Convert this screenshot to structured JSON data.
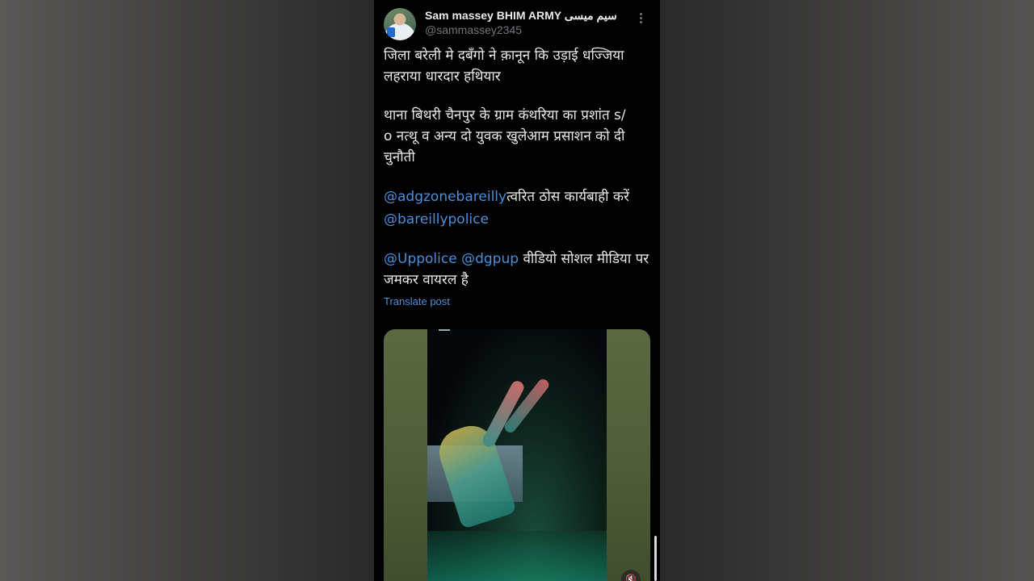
{
  "post": {
    "author_name": "Sam massey BHIM ARMY سیم میسی",
    "author_handle": "@sammassey2345",
    "line1": "जिला बरेली मे दबँगो ने क़ानून कि उड़ाई धज्जिया",
    "line2": "लहराया धारदार हथियार",
    "para2_line1": "थाना बिथरी चैनपुर के ग्राम कंथरिया का प्रशांत s/",
    "para2_line2": "o नत्थू व अन्य दो युवक खुलेआम प्रसाशन को दी",
    "para2_line3": "चुनौती",
    "mention1": "@adgzonebareilly",
    "mention1_text": "त्वरित ठोस कार्यबाही करें",
    "mention2": "@bareillypolice",
    "mention3": "@Uppolice",
    "mention4": "@dgpup",
    "para4_text": " वीडियो सोशल मीडिया पर",
    "para4_line2": "जमकर वायरल है",
    "translate_label": "Translate post"
  },
  "colors": {
    "link": "#4a8fd8",
    "text": "#e7e9ea",
    "muted": "#71767b"
  },
  "icons": {
    "more": "more-icon",
    "mute": "mute-icon"
  }
}
